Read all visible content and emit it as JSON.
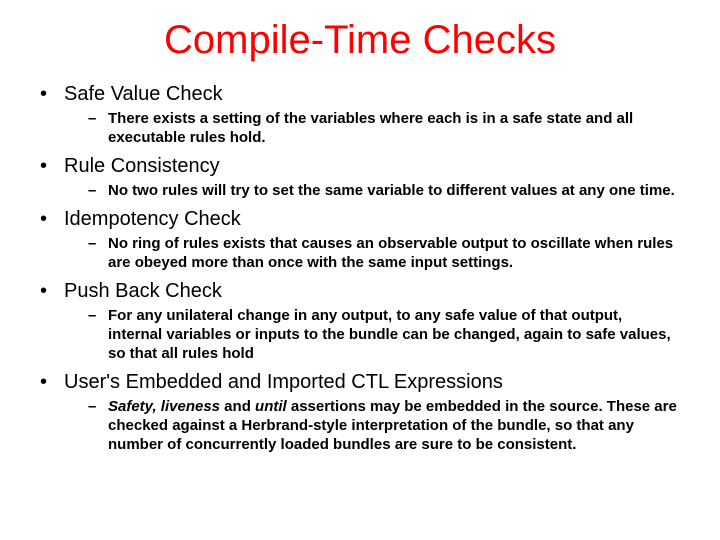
{
  "title": "Compile-Time Checks",
  "items": [
    {
      "heading": "Safe Value Check",
      "sub": "There exists a setting of the variables where each is in a safe state and all executable rules hold."
    },
    {
      "heading": "Rule Consistency",
      "sub": "No two rules will try to set the same variable to different values at any one time."
    },
    {
      "heading": "Idempotency Check",
      "sub": "No ring of rules exists that causes an observable output to oscillate when rules are obeyed more than once with the same input settings."
    },
    {
      "heading": "Push Back Check",
      "sub": "For any unilateral change in any output, to any safe value of that output, internal variables or inputs to the bundle can be changed, again to safe values, so that all rules hold"
    },
    {
      "heading": "User's Embedded and Imported CTL Expressions",
      "sub_html": "<span class='ital'>Safety, liveness</span> and <span class='ital'>until</span> assertions may be embedded in the source. These are checked against a Herbrand-style interpretation of the bundle, so that any number of concurrently loaded bundles are sure to be consistent."
    }
  ]
}
